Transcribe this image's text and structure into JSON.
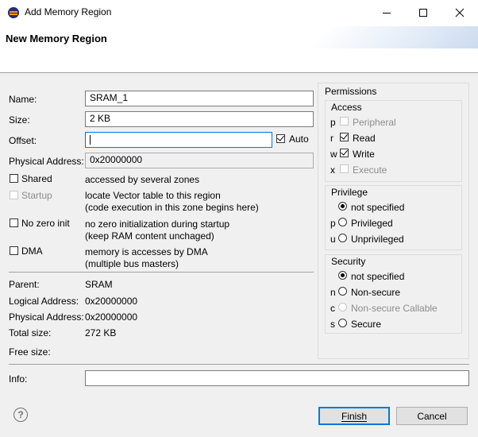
{
  "window": {
    "title": "Add Memory Region"
  },
  "banner": {
    "title": "New Memory Region"
  },
  "form": {
    "name_label": "Name:",
    "name_value": "SRAM_1",
    "size_label": "Size:",
    "size_value": "2 KB",
    "offset_label": "Offset:",
    "offset_value": "",
    "auto_label": "Auto",
    "auto_checked": true,
    "phys_label": "Physical Address:",
    "phys_value": "0x20000000",
    "options": [
      {
        "label": "Shared",
        "checked": false,
        "enabled": true,
        "desc1": "accessed by several zones",
        "desc2": ""
      },
      {
        "label": "Startup",
        "checked": false,
        "enabled": false,
        "desc1": "locate Vector table to this region",
        "desc2": "(code execution in this zone begins here)"
      },
      {
        "label": "No zero init",
        "checked": false,
        "enabled": true,
        "desc1": "no zero initialization during startup",
        "desc2": "(keep RAM content unchaged)"
      },
      {
        "label": "DMA",
        "checked": false,
        "enabled": true,
        "desc1": "memory is accesses by DMA",
        "desc2": "(multiple bus masters)"
      }
    ]
  },
  "info": {
    "parent_label": "Parent:",
    "parent_value": "SRAM",
    "logical_label": "Logical Address:",
    "logical_value": "0x20000000",
    "physical_label": "Physical Address:",
    "physical_value": "0x20000000",
    "total_label": "Total size:",
    "total_value": "272 KB",
    "free_label": "Free size:",
    "free_value": "",
    "info_label": "Info:",
    "info_value": ""
  },
  "permissions": {
    "title": "Permissions",
    "access": {
      "title": "Access",
      "items": [
        {
          "key": "p",
          "label": "Peripheral",
          "checked": false,
          "enabled": false
        },
        {
          "key": "r",
          "label": "Read",
          "checked": true,
          "enabled": true
        },
        {
          "key": "w",
          "label": "Write",
          "checked": true,
          "enabled": true
        },
        {
          "key": "x",
          "label": "Execute",
          "checked": false,
          "enabled": false
        }
      ]
    },
    "privilege": {
      "title": "Privilege",
      "items": [
        {
          "key": "",
          "label": "not specified",
          "selected": true,
          "enabled": true
        },
        {
          "key": "p",
          "label": "Privileged",
          "selected": false,
          "enabled": true
        },
        {
          "key": "u",
          "label": "Unprivileged",
          "selected": false,
          "enabled": true
        }
      ]
    },
    "security": {
      "title": "Security",
      "items": [
        {
          "key": "",
          "label": "not specified",
          "selected": true,
          "enabled": true
        },
        {
          "key": "n",
          "label": "Non-secure",
          "selected": false,
          "enabled": true
        },
        {
          "key": "c",
          "label": "Non-secure Callable",
          "selected": false,
          "enabled": false
        },
        {
          "key": "s",
          "label": "Secure",
          "selected": false,
          "enabled": true
        }
      ]
    }
  },
  "buttons": {
    "finish": "Finish",
    "cancel": "Cancel",
    "help": "?"
  },
  "colors": {
    "accent": "#0078d7",
    "background": "#f0f0f0"
  }
}
